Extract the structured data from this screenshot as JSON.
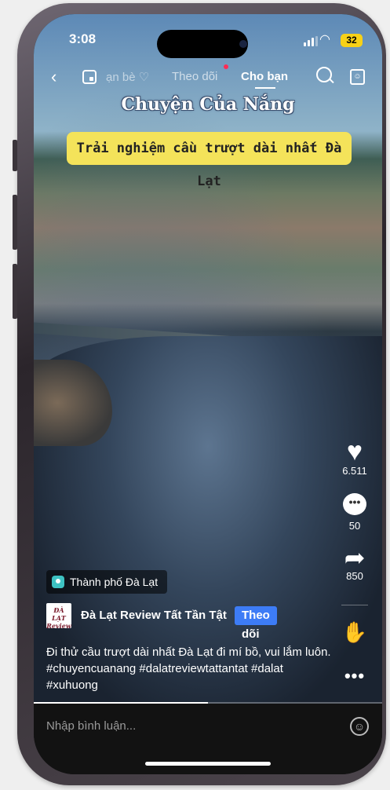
{
  "status": {
    "time": "3:08",
    "battery": "32"
  },
  "nav": {
    "tab_friends": "ạn bè ♡",
    "tab_following": "Theo dõi",
    "tab_foryou": "Cho bạn",
    "icons": [
      "back-arrow-icon",
      "live-icon",
      "search-icon",
      "profile-icon"
    ]
  },
  "video": {
    "title": "Chuyện Của Nắng",
    "subtitle": "Trải nghiệm cầu trượt dài nhất Đà Lạt",
    "progress": 0.5
  },
  "rail": {
    "likes": "6.511",
    "comments": "50",
    "shares": "850"
  },
  "location": {
    "label": "Thành phố Đà Lạt"
  },
  "author": {
    "name": "Đà Lạt Review Tất Tần Tật",
    "follow_label": "Theo dõi",
    "avatar_text": "ĐÀ LẠT Review"
  },
  "caption": "Đi thử cầu trượt dài nhất Đà Lạt đi mí bồ, vui lắm luôn. #chuyencuanang #dalatreviewtattantat #dalat #xuhuong",
  "comment": {
    "placeholder": "Nhập bình luận..."
  },
  "colors": {
    "accent": "#fe2c55",
    "follow": "#3d7cf6",
    "subtitle_bg": "#f4e35a"
  }
}
